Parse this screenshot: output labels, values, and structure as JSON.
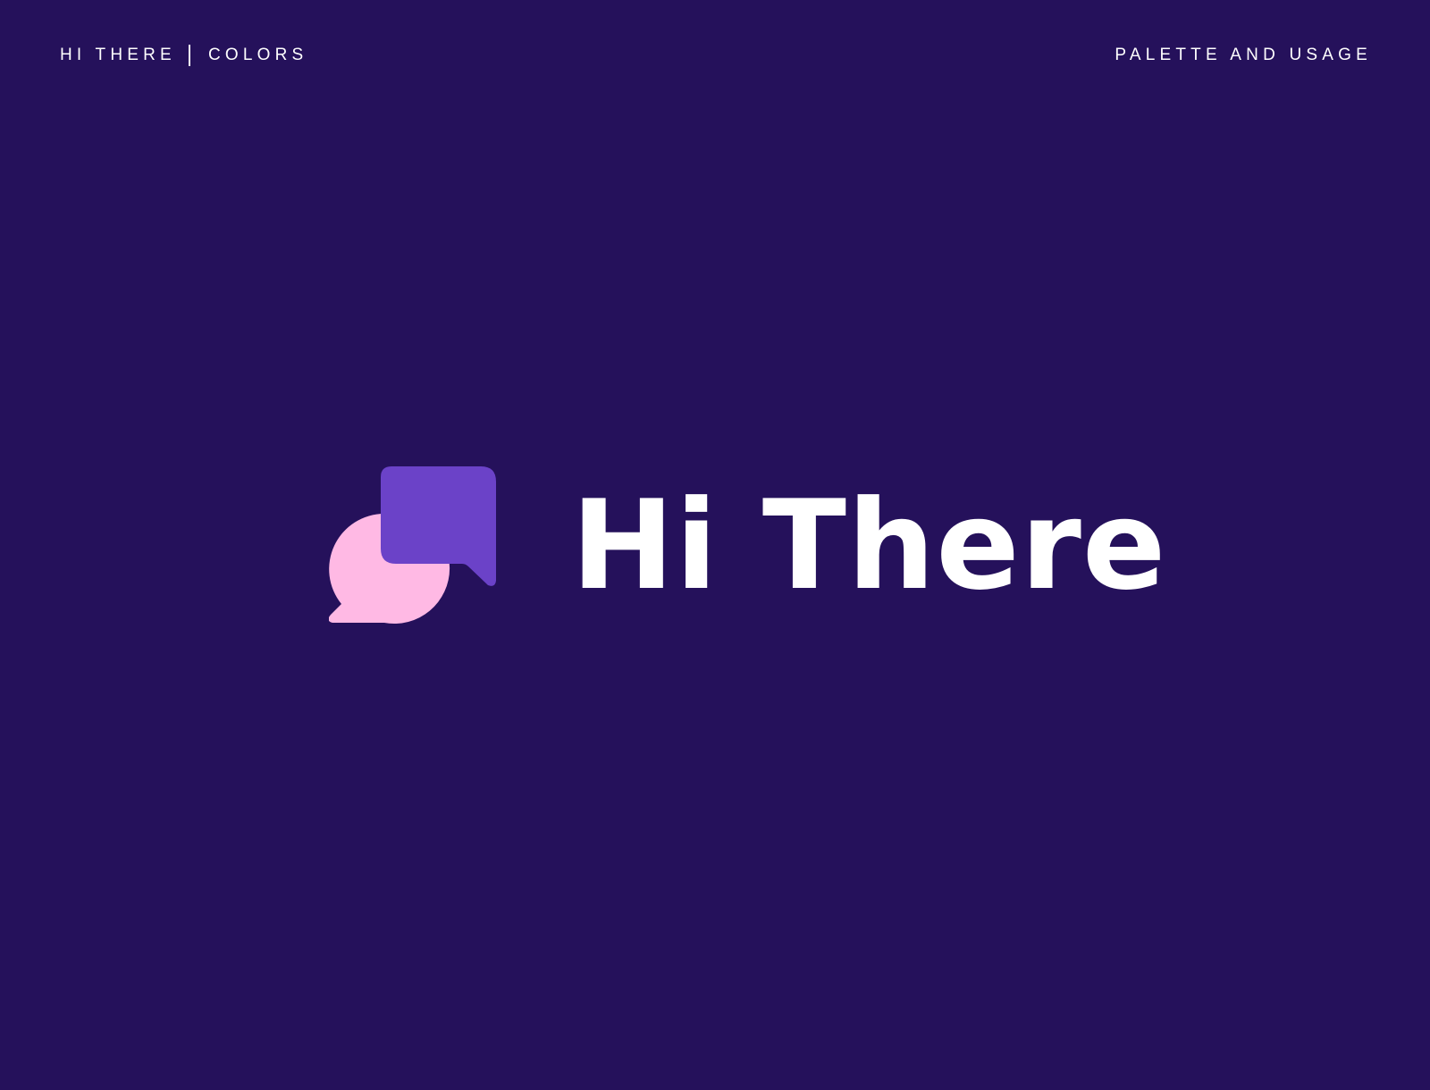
{
  "header": {
    "brand": "HI THERE",
    "section": "COLORS",
    "subtitle": "PALETTE AND USAGE"
  },
  "logo": {
    "wordmark": "Hi There",
    "icon": "chat-bubbles-icon"
  },
  "colors": {
    "background": "#25115b",
    "bubble_back": "#ffb9e4",
    "bubble_front": "#6b42c8",
    "text": "#ffffff"
  }
}
